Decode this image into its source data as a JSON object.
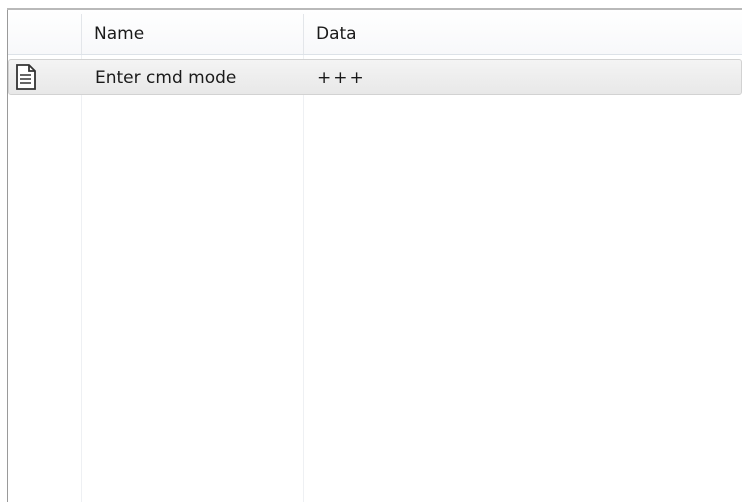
{
  "list": {
    "columns": {
      "icon": "",
      "name": "Name",
      "data": "Data"
    },
    "rows": [
      {
        "icon": "document-icon",
        "name": "Enter cmd mode",
        "data": "+++"
      }
    ]
  },
  "colors": {
    "row_background": "#ececec",
    "border": "#9a9a9a"
  }
}
